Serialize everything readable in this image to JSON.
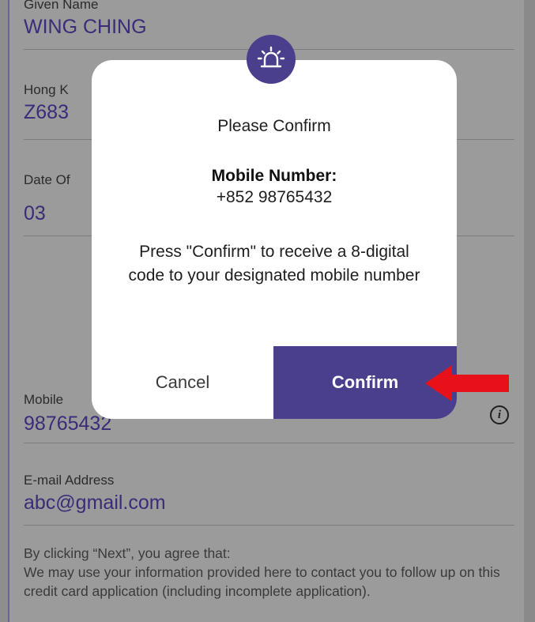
{
  "form": {
    "given_name_label": "Given Name",
    "given_name_value": "WING CHING",
    "hkid_label": "Hong K",
    "hkid_value": "Z683",
    "dob_label": "Date Of",
    "dob_value": "03",
    "mobile_label": "Mobile",
    "mobile_value": "98765432",
    "email_label": "E-mail Address",
    "email_value": "abc@gmail.com",
    "info_icon": "info-icon",
    "consent_line1": "By clicking “Next”, you agree that:",
    "consent_line2": "We may use your information provided here to contact you to follow up on this credit card application (including incomplete application)."
  },
  "modal": {
    "icon": "siren-icon",
    "title": "Please Confirm",
    "field_label": "Mobile Number:",
    "field_value": "+852 98765432",
    "message": "Press \"Confirm\" to receive a 8-digital code to your designated mobile number",
    "cancel_label": "Cancel",
    "confirm_label": "Confirm"
  },
  "annotation": {
    "icon": "arrow-left-icon",
    "color": "#e8111a"
  },
  "colors": {
    "accent": "#4a3f8c",
    "field_text": "#3b2b78",
    "overlay": "#9b9b9b"
  }
}
